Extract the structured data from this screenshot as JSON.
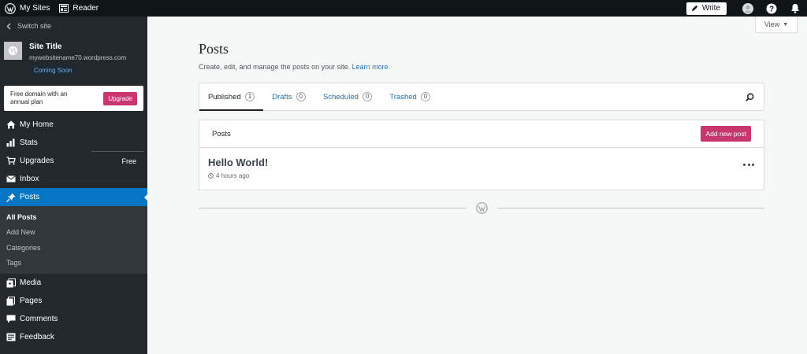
{
  "masterbar": {
    "my_sites": "My Sites",
    "reader": "Reader",
    "write": "Write"
  },
  "sidebar": {
    "switch_site": "Switch site",
    "site_title": "Site Title",
    "site_url": "mywebsitename70.wordpress.com",
    "status": "Coming Soon",
    "upgrade_text": "Free domain with an annual plan",
    "upgrade_button": "Upgrade",
    "menu": {
      "home": "My Home",
      "stats": "Stats",
      "upgrades": "Upgrades",
      "upgrades_badge": "Free",
      "inbox": "Inbox",
      "posts": "Posts",
      "media": "Media",
      "pages": "Pages",
      "comments": "Comments",
      "feedback": "Feedback"
    },
    "submenu": [
      "All Posts",
      "Add New",
      "Categories",
      "Tags"
    ]
  },
  "main": {
    "view": "View",
    "title": "Posts",
    "subtitle": "Create, edit, and manage the posts on your site.",
    "learn_more": "Learn more.",
    "tabs": [
      {
        "label": "Published",
        "count": "1"
      },
      {
        "label": "Drafts",
        "count": "0"
      },
      {
        "label": "Scheduled",
        "count": "0"
      },
      {
        "label": "Trashed",
        "count": "0"
      }
    ],
    "posts_header": "Posts",
    "add_new_post": "Add new post",
    "post": {
      "title": "Hello World!",
      "time": "4 hours ago"
    }
  },
  "colors": {
    "accent": "#0675c4",
    "pink": "#c9356e",
    "sidebar_bg": "#23282d",
    "masterbar_bg": "#101517"
  }
}
